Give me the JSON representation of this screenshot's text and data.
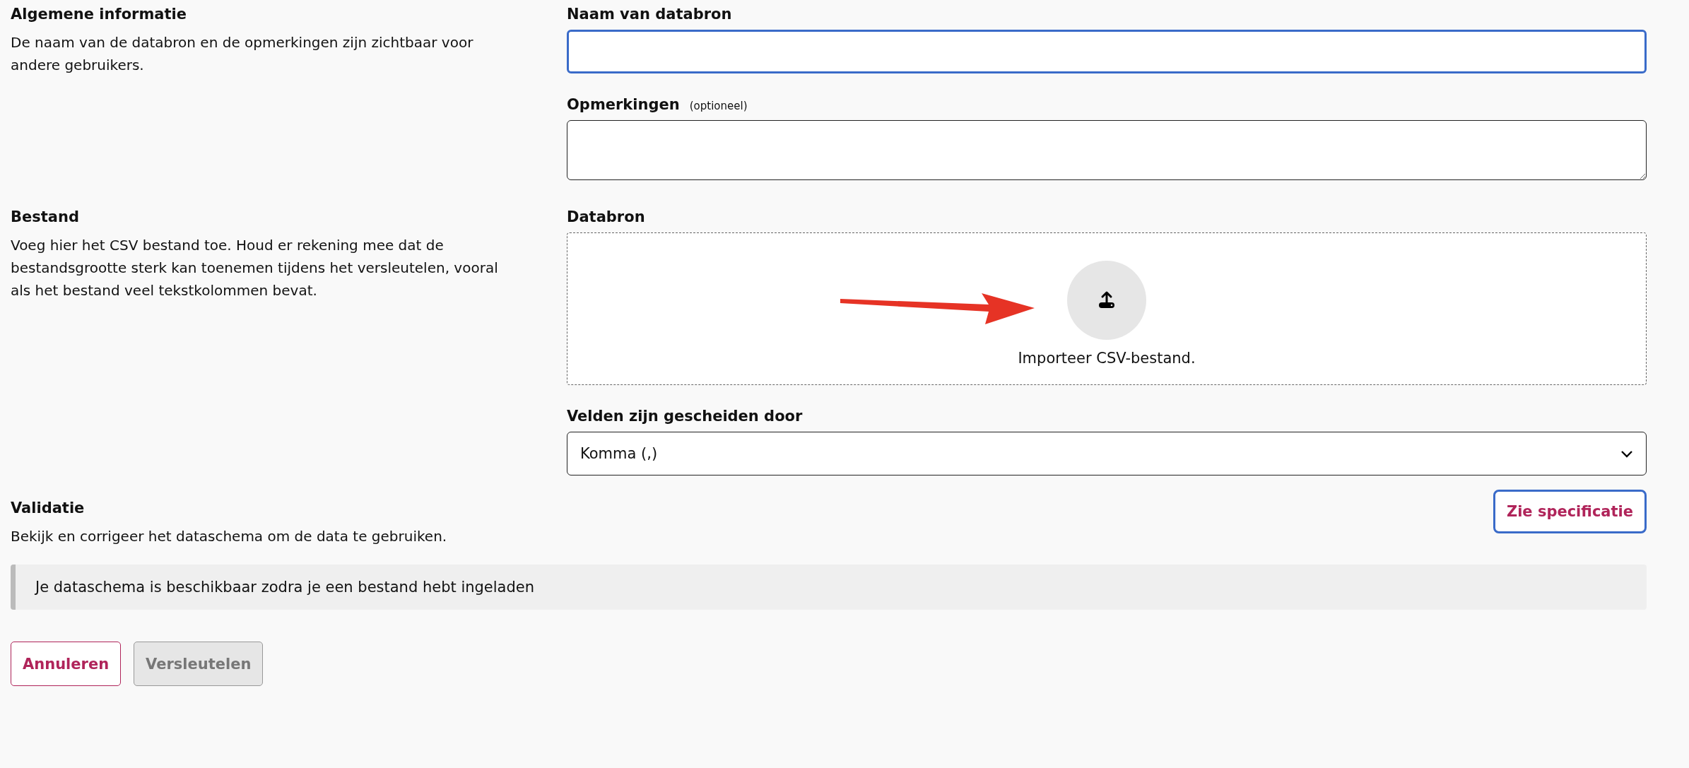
{
  "sections": [
    {
      "kind": "general",
      "title": "Algemene informatie",
      "description": "De naam van de databron en de opmerkingen zijn zichtbaar voor andere gebruikers.",
      "fields": [
        {
          "kind": "input",
          "label": "Naam van databron",
          "focused": true
        },
        {
          "kind": "textarea",
          "label": "Opmerkingen",
          "hint": "(optioneel)",
          "focused": false
        }
      ]
    },
    {
      "kind": "file",
      "title": "Bestand",
      "description": "Voeg hier het CSV bestand toe. Houd er rekening mee dat de bestandsgrootte sterk kan toenemen tijdens het versleutelen, vooral als het bestand veel tekstkolommen bevat.",
      "fields": [
        {
          "kind": "dropzone",
          "label": "Databron",
          "text": "Importeer CSV-bestand."
        },
        {
          "kind": "select",
          "label": "Velden zijn gescheiden door",
          "value": "Komma (,)",
          "focused": false
        }
      ]
    },
    {
      "kind": "validation",
      "title": "Validatie",
      "description": "Bekijk en corrigeer het dataschema om de data te gebruiken.",
      "button": {
        "label": "Zie specificatie",
        "focused": true
      },
      "notice": "Je dataschema is beschikbaar zodra je een bestand hebt ingeladen"
    }
  ],
  "actions": [
    {
      "label": "Annuleren",
      "disabled": false
    },
    {
      "label": "Versleutelen",
      "disabled": true
    }
  ]
}
